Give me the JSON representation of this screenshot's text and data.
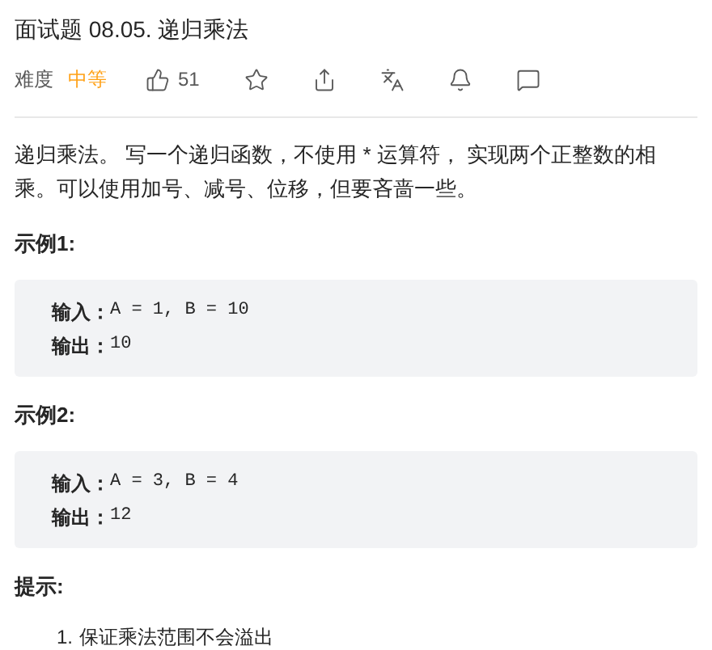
{
  "title": "面试题 08.05. 递归乘法",
  "meta": {
    "difficulty_label": "难度",
    "difficulty": "中等",
    "likes": "51"
  },
  "description": "递归乘法。 写一个递归函数，不使用 * 运算符， 实现两个正整数的相乘。可以使用加号、减号、位移，但要吝啬一些。",
  "examples": [
    {
      "heading": "示例1:",
      "lines": [
        {
          "label": "输入：",
          "value": "A = 1, B = 10"
        },
        {
          "label": "输出：",
          "value": "10"
        }
      ]
    },
    {
      "heading": "示例2:",
      "lines": [
        {
          "label": "输入：",
          "value": "A = 3, B = 4"
        },
        {
          "label": "输出：",
          "value": "12"
        }
      ]
    }
  ],
  "hints": {
    "heading": "提示:",
    "items": [
      {
        "number": "1.",
        "text": "保证乘法范围不会溢出"
      }
    ]
  }
}
